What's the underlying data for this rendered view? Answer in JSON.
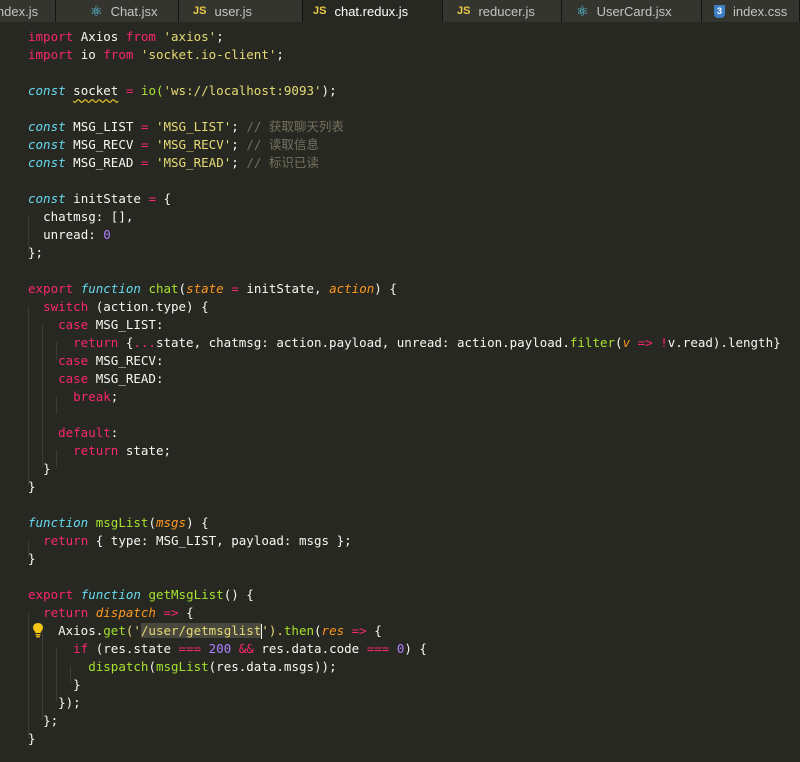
{
  "tabs": [
    {
      "label": "index.js",
      "icon": "js-icon",
      "active": false
    },
    {
      "label": "Chat.jsx",
      "icon": "react-icon",
      "active": false
    },
    {
      "label": "user.js",
      "icon": "js-icon",
      "active": false
    },
    {
      "label": "chat.redux.js",
      "icon": "js-icon",
      "active": true
    },
    {
      "label": "reducer.js",
      "icon": "js-icon",
      "active": false
    },
    {
      "label": "UserCard.jsx",
      "icon": "react-icon",
      "active": false
    },
    {
      "label": "index.css",
      "icon": "css-icon",
      "active": false
    }
  ],
  "tab_icon_text": {
    "js": "JS",
    "css": "3"
  },
  "code": {
    "l1": [
      "import",
      "Axios",
      "from",
      "'axios'",
      ";"
    ],
    "l2": [
      "import",
      "io",
      "from",
      "'socket.io-client'",
      ";"
    ],
    "l4": [
      "const",
      "socket",
      "=",
      "io(",
      "'ws://localhost:9093'",
      ");"
    ],
    "l6": [
      "const",
      "MSG_LIST",
      "=",
      "'MSG_LIST'",
      ";",
      "// 获取聊天列表"
    ],
    "l7": [
      "const",
      "MSG_RECV",
      "=",
      "'MSG_RECV'",
      ";",
      "// 读取信息"
    ],
    "l8": [
      "const",
      "MSG_READ",
      "=",
      "'MSG_READ'",
      ";",
      "// 标识已读"
    ],
    "l10": [
      "const",
      "initState",
      "=",
      "{"
    ],
    "l11": [
      "chatmsg: [],"
    ],
    "l12": [
      "unread:",
      "0"
    ],
    "l13": [
      "};"
    ],
    "l15": [
      "export",
      "function",
      "chat",
      "(",
      "state",
      "=",
      "initState, ",
      "action",
      ") {"
    ],
    "l16": [
      "switch",
      "(action.type) {"
    ],
    "l17": [
      "case",
      "MSG_LIST:"
    ],
    "l18": [
      "return",
      "{",
      "...",
      "state, chatmsg: action.payload, unread: action.payload.",
      "filter",
      "(",
      "v",
      "=>",
      "!",
      "v.read).length}"
    ],
    "l19": [
      "case",
      "MSG_RECV:"
    ],
    "l20": [
      "case",
      "MSG_READ:"
    ],
    "l21": [
      "break",
      ";"
    ],
    "l23": [
      "default",
      ":"
    ],
    "l24": [
      "return",
      "state;"
    ],
    "l25": [
      "}"
    ],
    "l26": [
      "}"
    ],
    "l28": [
      "function",
      "msgList",
      "(",
      "msgs",
      ") {"
    ],
    "l29": [
      "return",
      "{ type: MSG_LIST, payload: msgs };"
    ],
    "l30": [
      "}"
    ],
    "l32": [
      "export",
      "function",
      "getMsgList",
      "() {"
    ],
    "l33": [
      "return",
      "dispatch",
      "=>",
      "{"
    ],
    "l34": [
      "Axios.",
      "get",
      "('",
      "/user/getmsglist",
      "').",
      "then",
      "(",
      "res",
      "=>",
      "{"
    ],
    "l35": [
      "if",
      "(res.state",
      "===",
      "200",
      "&&",
      "res.data.code",
      "===",
      "0",
      ") {"
    ],
    "l36": [
      "dispatch",
      "(",
      "msgList",
      "(res.data.msgs));"
    ],
    "l37": [
      "}"
    ],
    "l38": [
      "});"
    ],
    "l39": [
      "};"
    ],
    "l40": [
      "}"
    ]
  }
}
